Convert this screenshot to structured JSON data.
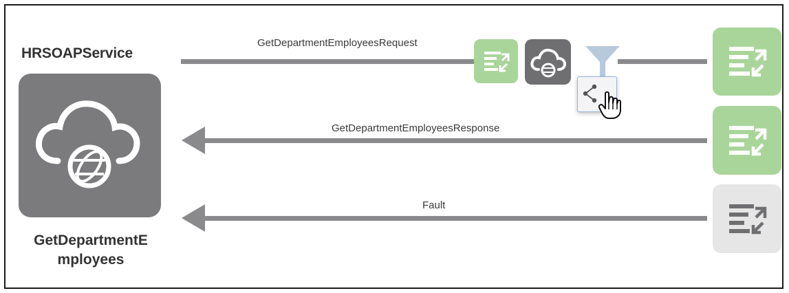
{
  "service": {
    "name": "HRSOAPService",
    "operation_lines": [
      "GetDepartmentE",
      "mployees"
    ]
  },
  "flows": {
    "request_label": "GetDepartmentEmployeesRequest",
    "response_label": "GetDepartmentEmployeesResponse",
    "fault_label": "Fault"
  },
  "icons": {
    "service": "cloud-globe-icon",
    "request_mapper": "map-transform-icon",
    "request_cloud": "cloud-globe-icon",
    "filter": "filter-funnel-icon",
    "share": "share-icon",
    "cursor": "hand-pointer-icon",
    "request_map": "map-transform-icon",
    "response_map": "map-transform-icon",
    "fault_map": "map-transform-icon"
  },
  "colors": {
    "lane": "#8a8a8c",
    "tile_dark": "#7b7b7d",
    "map_active": "#a9d59b",
    "map_inactive": "#e6e6e6",
    "filter": "#b8c9dc"
  }
}
